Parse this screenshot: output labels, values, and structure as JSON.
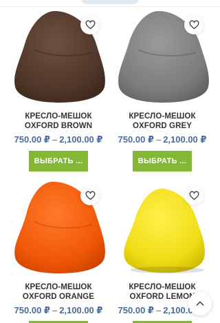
{
  "currency": "₽",
  "icons": {
    "wishlist": "heart-outline-icon",
    "scroll_top": "chevron-up-icon"
  },
  "products": [
    {
      "title": "КРЕСЛО-МЕШОК OXFORD BROWN",
      "price_min": "750.00 ₽",
      "price_max": "2,100.00 ₽",
      "button": "ВЫБРАТЬ ...",
      "color": "#5a4030"
    },
    {
      "title": "КРЕСЛО-МЕШОК OXFORD GREY",
      "price_min": "750.00 ₽",
      "price_max": "2,100.00 ₽",
      "button": "ВЫБРАТЬ ...",
      "color": "#8a8a8a"
    },
    {
      "title": "КРЕСЛО-МЕШОК OXFORD ORANGE",
      "price_min": "750.00 ₽",
      "price_max": "2,100.00 ₽",
      "button": "",
      "color": "#f05a0a"
    },
    {
      "title": "КРЕСЛО-МЕШОК OXFORD LEMON",
      "price_min": "750.00 ₽",
      "price_max": "2,100.00 ₽",
      "button": "",
      "color": "#f3e21a"
    }
  ],
  "button_color": "#83b735",
  "price_color": "#4a6b9c"
}
